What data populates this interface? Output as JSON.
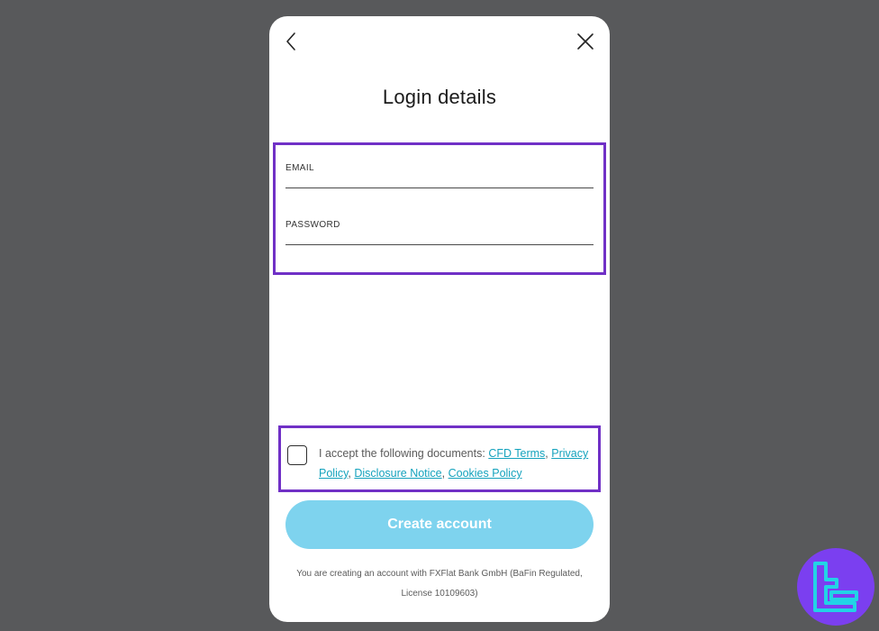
{
  "modal": {
    "title": "Login details",
    "icons": {
      "back": "chevron-left-icon",
      "close": "close-icon"
    }
  },
  "form": {
    "email": {
      "label": "EMAIL",
      "value": "",
      "placeholder": ""
    },
    "password": {
      "label": "PASSWORD",
      "value": "",
      "placeholder": ""
    }
  },
  "consent": {
    "checked": false,
    "intro": "I accept the following documents: ",
    "links": [
      "CFD Terms",
      "Privacy Policy",
      "Disclosure Notice",
      "Cookies Policy"
    ],
    "separator": ", "
  },
  "actions": {
    "create_account_label": "Create account"
  },
  "footer": {
    "text": "You are creating an account with FXFlat Bank GmbH (BaFin Regulated, License 10109603)"
  },
  "colors": {
    "highlight": "#7030c6",
    "primary_button": "#7ed3ee",
    "link": "#14a2bd",
    "backdrop": "#58595b",
    "logo_bg": "#7b3ff0",
    "logo_fg": "#22d3e6"
  },
  "watermark": {
    "icon": "tradingfinder-logo-icon"
  }
}
